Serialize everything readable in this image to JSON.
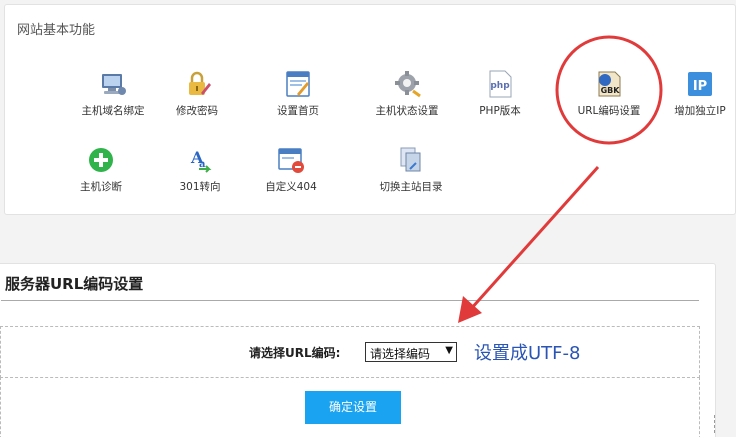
{
  "top_panel": {
    "title": "网站基本功能",
    "items": [
      {
        "label": "主机域名绑定",
        "icon": "computer-icon"
      },
      {
        "label": "修改密码",
        "icon": "lock-edit-icon"
      },
      {
        "label": "设置首页",
        "icon": "homepage-settings-icon"
      },
      {
        "label": "主机状态设置",
        "icon": "gear-icon"
      },
      {
        "label": "PHP版本",
        "icon": "php-icon",
        "icon_text": "php"
      },
      {
        "label": "URL编码设置",
        "icon": "gbk-encoding-icon",
        "icon_text": "GBK"
      },
      {
        "label": "增加独立IP",
        "icon": "ip-icon",
        "icon_text": "IP"
      },
      {
        "label": "主机诊断",
        "icon": "plus-circle-icon"
      },
      {
        "label": "301转向",
        "icon": "redirect-icon"
      },
      {
        "label": "自定义404",
        "icon": "custom-404-icon"
      },
      {
        "label": "切换主站目录",
        "icon": "switch-directory-icon"
      }
    ]
  },
  "bottom_panel": {
    "title": "服务器URL编码设置",
    "field_label": "请选择URL编码:",
    "select_value": "请选择编码",
    "annotation": "设置成UTF-8",
    "confirm_label": "确定设置"
  },
  "colors": {
    "highlight_circle": "#e03a3a",
    "arrow": "#e03a3a",
    "annotation_text": "#2a55b5",
    "button": "#1aa3f0"
  }
}
